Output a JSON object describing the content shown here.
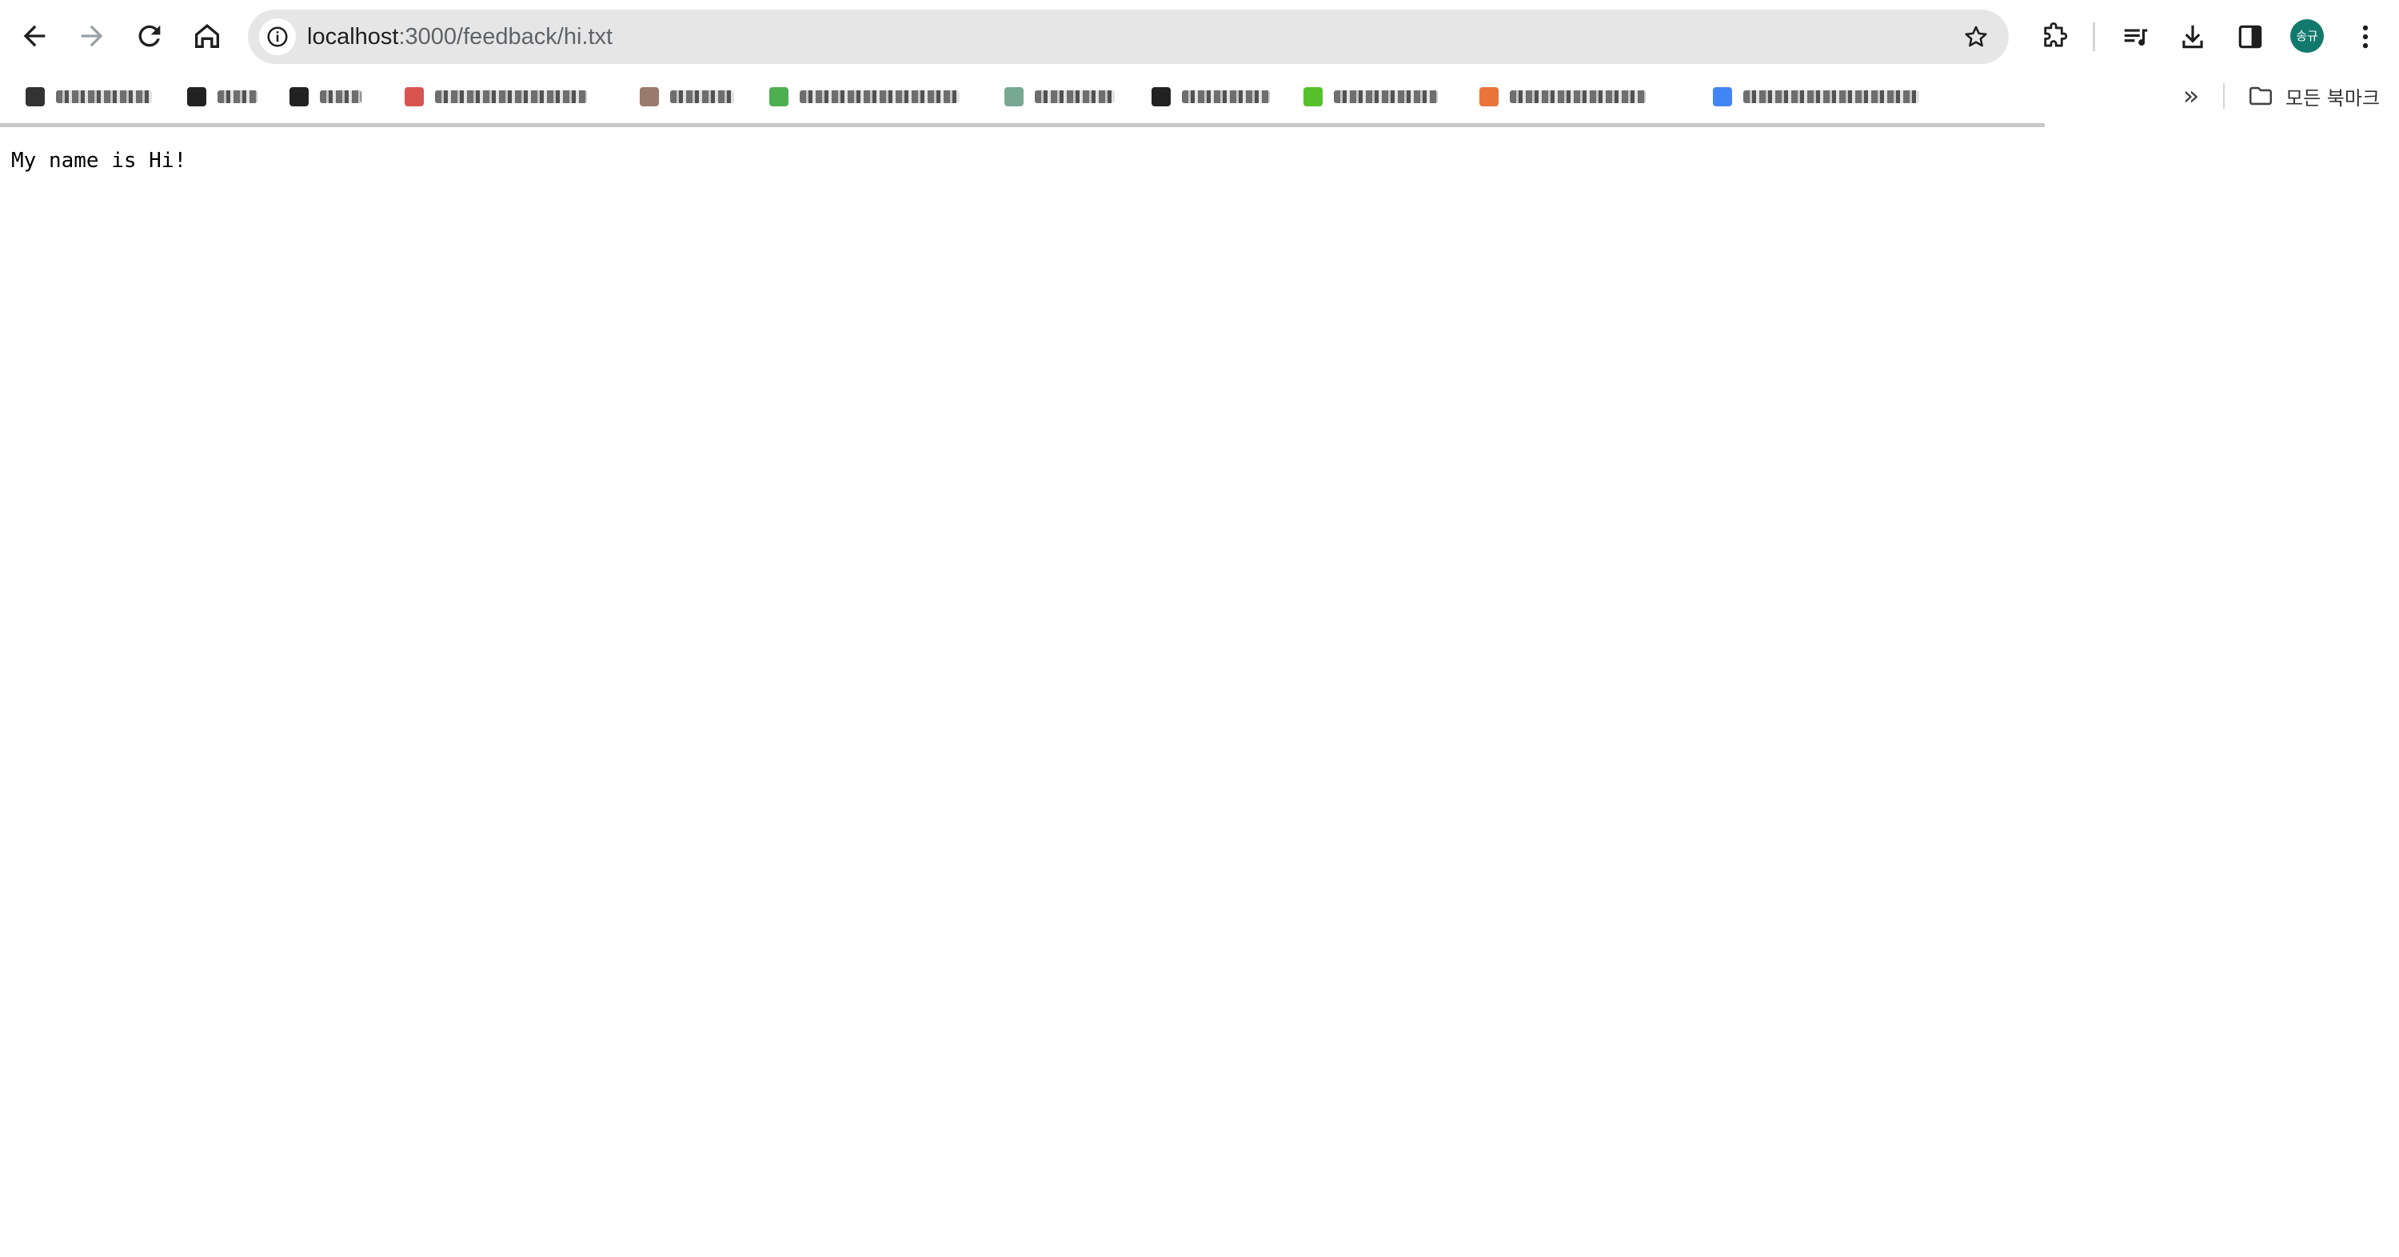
{
  "browser": {
    "url_host": "localhost",
    "url_path": ":3000/feedback/hi.txt",
    "avatar_text": "송규",
    "all_bookmarks_label": "모든 북마크"
  },
  "bookmarks": [
    {
      "favicon_color": "#333333",
      "note": "blurred"
    },
    {
      "favicon_color": "#222222",
      "note": "blurred"
    },
    {
      "favicon_color": "#222222",
      "note": "blurred"
    },
    {
      "favicon_color": "#d9534f",
      "note": "blurred"
    },
    {
      "favicon_color": "#9a7a6a",
      "note": "blurred"
    },
    {
      "favicon_color": "#4caf50",
      "note": "blurred"
    },
    {
      "favicon_color": "#79a892",
      "note": "blurred"
    },
    {
      "favicon_color": "#222222",
      "note": "blurred"
    },
    {
      "favicon_color": "#56c02b",
      "note": "blurred"
    },
    {
      "favicon_color": "#e8743b",
      "note": "blurred"
    },
    {
      "favicon_color": "#4285f4",
      "note": "blurred"
    }
  ],
  "page": {
    "text": "My name is Hi!"
  }
}
